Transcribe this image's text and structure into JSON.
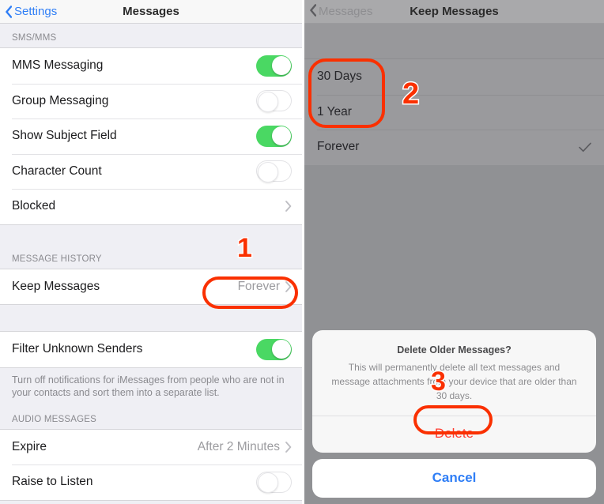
{
  "left_panel": {
    "nav": {
      "back_label": "Settings",
      "title": "Messages"
    },
    "sections": [
      {
        "header": "SMS/MMS",
        "rows": [
          {
            "label": "MMS Messaging",
            "control": "toggle",
            "state": "on"
          },
          {
            "label": "Group Messaging",
            "control": "toggle",
            "state": "off"
          },
          {
            "label": "Show Subject Field",
            "control": "toggle",
            "state": "on"
          },
          {
            "label": "Character Count",
            "control": "toggle",
            "state": "off"
          },
          {
            "label": "Blocked",
            "control": "disclosure",
            "value": ""
          }
        ]
      },
      {
        "header": "MESSAGE HISTORY",
        "rows": [
          {
            "label": "Keep Messages",
            "control": "disclosure",
            "value": "Forever"
          }
        ]
      },
      {
        "header": "",
        "rows": [
          {
            "label": "Filter Unknown Senders",
            "control": "toggle",
            "state": "on"
          }
        ],
        "footnote": "Turn off notifications for iMessages from people who are not in your contacts and sort them into a separate list."
      },
      {
        "header": "AUDIO MESSAGES",
        "rows": [
          {
            "label": "Expire",
            "control": "disclosure",
            "value": "After 2 Minutes"
          },
          {
            "label": "Raise to Listen",
            "control": "toggle",
            "state": "off"
          }
        ]
      }
    ]
  },
  "right_panel": {
    "nav": {
      "back_label": "Messages",
      "title": "Keep Messages"
    },
    "options": [
      {
        "label": "30 Days",
        "selected": false
      },
      {
        "label": "1 Year",
        "selected": false
      },
      {
        "label": "Forever",
        "selected": true
      }
    ],
    "alert": {
      "title": "Delete Older Messages?",
      "message": "This will permanently delete all text messages and message attachments from your device that are older than 30 days.",
      "destructive_label": "Delete",
      "cancel_label": "Cancel"
    }
  },
  "annotations": {
    "step1": "1",
    "step2": "2",
    "step3": "3"
  },
  "colors": {
    "accent_blue": "#2F7EF6",
    "toggle_green": "#4AD863",
    "destructive_red": "#FF3B30",
    "annotation_red": "#FA3000",
    "panel_bg": "#EFEFF4",
    "dim_overlay": "#909194"
  }
}
